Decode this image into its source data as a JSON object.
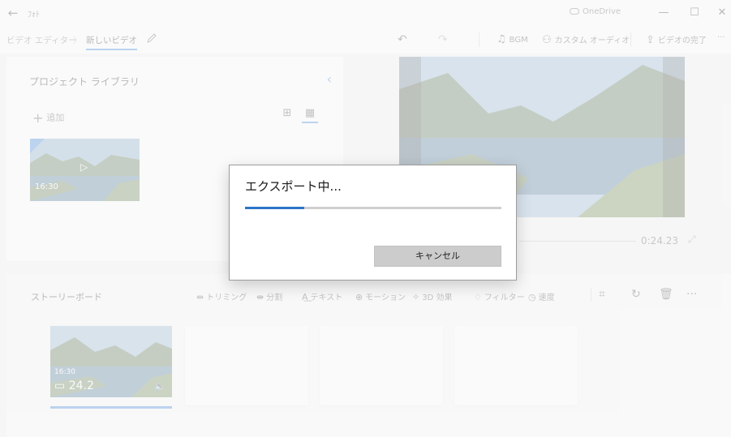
{
  "titlebar": {
    "back_glyph": "←",
    "app_name": "ﾌｫﾄ",
    "onedrive_label": "OneDrive",
    "minimize_glyph": "—",
    "maximize_glyph": "☐",
    "close_glyph": "✕"
  },
  "commandbar": {
    "breadcrumb_parent": "ビデオ エディター",
    "breadcrumb_sep": "〉",
    "breadcrumb_current": "新しいビデオ",
    "undo_glyph": "↶",
    "redo_glyph": "↷",
    "bgm_label": "BGM",
    "custom_audio_label": "カスタム オーディオ",
    "finish_label": "ビデオの完了",
    "more_glyph": "···"
  },
  "library": {
    "title": "プロジェクト ライブラリ",
    "add_label": "追加",
    "thumb_duration": "16:30"
  },
  "preview": {
    "timecode": "0:24.23"
  },
  "storyboard": {
    "title": "ストーリーボード",
    "tools": {
      "trim": "トリミング",
      "split": "分割",
      "text": "テキスト",
      "motion": "モーション",
      "effects3d": "3D 効果",
      "filters": "フィルター",
      "speed": "速度"
    },
    "more_glyph": "···",
    "clip_tag": "16:30",
    "clip_duration": "24.2"
  },
  "export_dialog": {
    "title": "エクスポート中...",
    "progress_fraction": 0.23,
    "cancel_label": "キャンセル"
  },
  "colors": {
    "accent": "#2b7bd6",
    "progress": "#2b74c8"
  }
}
